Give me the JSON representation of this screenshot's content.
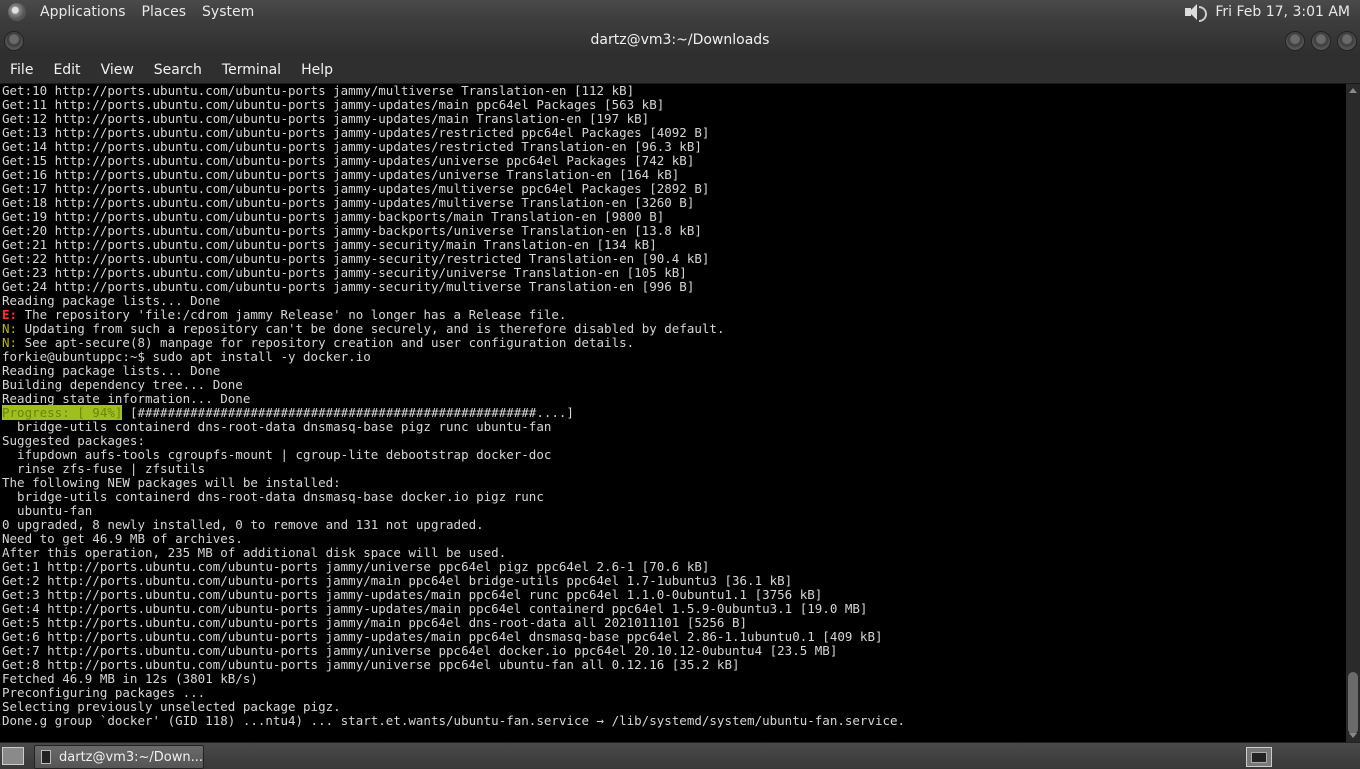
{
  "top_panel": {
    "menus": [
      "Applications",
      "Places",
      "System"
    ],
    "clock": "Fri Feb 17,  3:01 AM",
    "volume_icon": "speaker-icon"
  },
  "window": {
    "title": "dartz@vm3:~/Downloads"
  },
  "menubar": [
    "File",
    "Edit",
    "View",
    "Search",
    "Terminal",
    "Help"
  ],
  "terminal": {
    "lines": [
      "Get:10 http://ports.ubuntu.com/ubuntu-ports jammy/multiverse Translation-en [112 kB]",
      "Get:11 http://ports.ubuntu.com/ubuntu-ports jammy-updates/main ppc64el Packages [563 kB]",
      "Get:12 http://ports.ubuntu.com/ubuntu-ports jammy-updates/main Translation-en [197 kB]",
      "Get:13 http://ports.ubuntu.com/ubuntu-ports jammy-updates/restricted ppc64el Packages [4092 B]",
      "Get:14 http://ports.ubuntu.com/ubuntu-ports jammy-updates/restricted Translation-en [96.3 kB]",
      "Get:15 http://ports.ubuntu.com/ubuntu-ports jammy-updates/universe ppc64el Packages [742 kB]",
      "Get:16 http://ports.ubuntu.com/ubuntu-ports jammy-updates/universe Translation-en [164 kB]",
      "Get:17 http://ports.ubuntu.com/ubuntu-ports jammy-updates/multiverse ppc64el Packages [2892 B]",
      "Get:18 http://ports.ubuntu.com/ubuntu-ports jammy-updates/multiverse Translation-en [3260 B]",
      "Get:19 http://ports.ubuntu.com/ubuntu-ports jammy-backports/main Translation-en [9800 B]",
      "Get:20 http://ports.ubuntu.com/ubuntu-ports jammy-backports/universe Translation-en [13.8 kB]",
      "Get:21 http://ports.ubuntu.com/ubuntu-ports jammy-security/main Translation-en [134 kB]",
      "Get:22 http://ports.ubuntu.com/ubuntu-ports jammy-security/restricted Translation-en [90.4 kB]",
      "Get:23 http://ports.ubuntu.com/ubuntu-ports jammy-security/universe Translation-en [105 kB]",
      "Get:24 http://ports.ubuntu.com/ubuntu-ports jammy-security/multiverse Translation-en [996 B]",
      "Reading package lists... Done",
      {
        "tag": "E:",
        "tag_class": "tag-e",
        "text": " The repository 'file:/cdrom jammy Release' no longer has a Release file."
      },
      {
        "tag": "N:",
        "tag_class": "tag-n",
        "text": " Updating from such a repository can't be done securely, and is therefore disabled by default."
      },
      {
        "tag": "N:",
        "tag_class": "tag-n",
        "text": " See apt-secure(8) manpage for repository creation and user configuration details."
      },
      "forkie@ubuntuppc:~$ sudo apt install -y docker.io",
      "Reading package lists... Done",
      "Building dependency tree... Done",
      "Reading state information... Done",
      {
        "tag": "Progress: [ 94%]",
        "tag_class": "progress-label",
        "text": " [#####################################################....]"
      },
      "  bridge-utils containerd dns-root-data dnsmasq-base pigz runc ubuntu-fan",
      "Suggested packages:",
      "  ifupdown aufs-tools cgroupfs-mount | cgroup-lite debootstrap docker-doc",
      "  rinse zfs-fuse | zfsutils",
      "The following NEW packages will be installed:",
      "  bridge-utils containerd dns-root-data dnsmasq-base docker.io pigz runc",
      "  ubuntu-fan",
      "0 upgraded, 8 newly installed, 0 to remove and 131 not upgraded.",
      "Need to get 46.9 MB of archives.",
      "After this operation, 235 MB of additional disk space will be used.",
      "Get:1 http://ports.ubuntu.com/ubuntu-ports jammy/universe ppc64el pigz ppc64el 2.6-1 [70.6 kB]",
      "Get:2 http://ports.ubuntu.com/ubuntu-ports jammy/main ppc64el bridge-utils ppc64el 1.7-1ubuntu3 [36.1 kB]",
      "Get:3 http://ports.ubuntu.com/ubuntu-ports jammy-updates/main ppc64el runc ppc64el 1.1.0-0ubuntu1.1 [3756 kB]",
      "Get:4 http://ports.ubuntu.com/ubuntu-ports jammy-updates/main ppc64el containerd ppc64el 1.5.9-0ubuntu3.1 [19.0 MB]",
      "Get:5 http://ports.ubuntu.com/ubuntu-ports jammy/main ppc64el dns-root-data all 2021011101 [5256 B]",
      "Get:6 http://ports.ubuntu.com/ubuntu-ports jammy-updates/main ppc64el dnsmasq-base ppc64el 2.86-1.1ubuntu0.1 [409 kB]",
      "Get:7 http://ports.ubuntu.com/ubuntu-ports jammy/universe ppc64el docker.io ppc64el 20.10.12-0ubuntu4 [23.5 MB]",
      "Get:8 http://ports.ubuntu.com/ubuntu-ports jammy/universe ppc64el ubuntu-fan all 0.12.16 [35.2 kB]",
      "Fetched 46.9 MB in 12s (3801 kB/s)",
      "Preconfiguring packages ...",
      "Selecting previously unselected package pigz.",
      "Done.g group `docker' (GID 118) ...ntu4) ... start.et.wants/ubuntu-fan.service → /lib/systemd/system/ubuntu-fan.service."
    ]
  },
  "taskbar": {
    "task_label": "dartz@vm3:~/Down..."
  }
}
